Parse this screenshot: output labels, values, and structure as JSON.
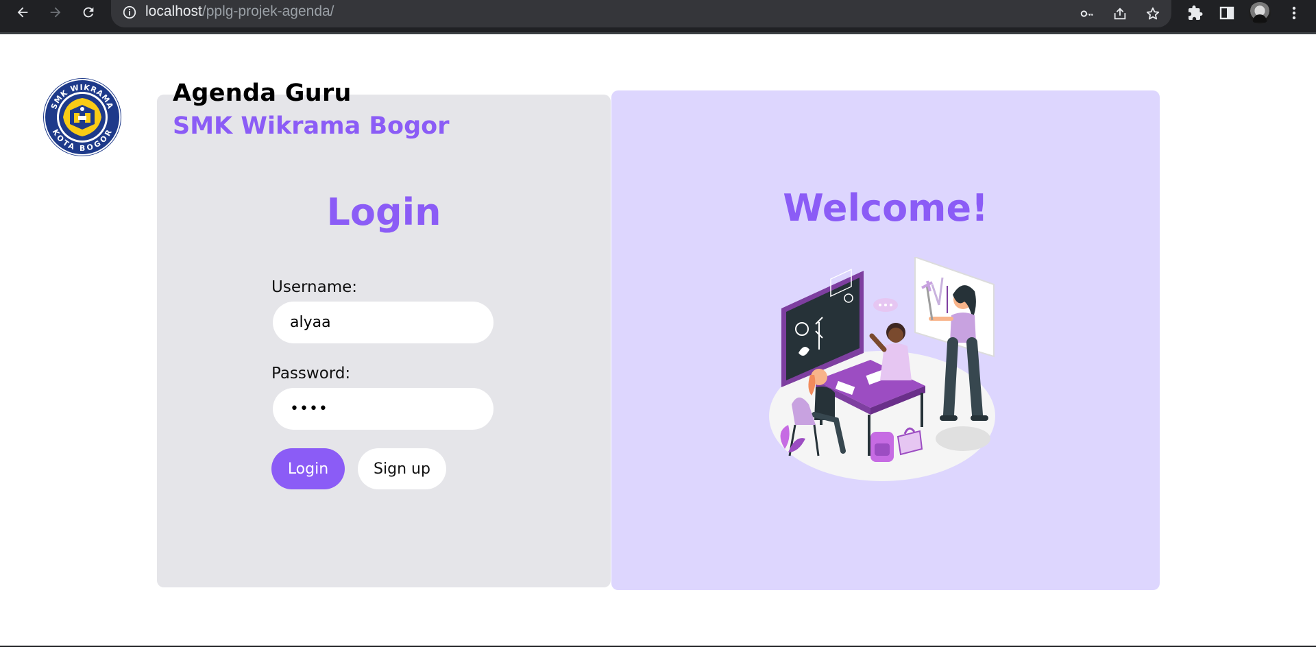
{
  "browser": {
    "url_host": "localhost",
    "url_path": "/pplg-projek-agenda/",
    "icons": [
      "back-icon",
      "forward-icon",
      "reload-icon",
      "site-info-icon",
      "key-icon",
      "share-icon",
      "star-icon",
      "extensions-icon",
      "side-panel-icon",
      "profile-avatar",
      "menu-icon"
    ]
  },
  "header": {
    "title": "Agenda Guru",
    "subtitle": "SMK Wikrama Bogor",
    "logo_text_top": "SMK WIKRAMA",
    "logo_text_bottom": "KOTA BOGOR"
  },
  "login": {
    "heading": "Login",
    "username_label": "Username:",
    "username_value": "alyaa",
    "password_label": "Password:",
    "password_value": "••••",
    "login_button": "Login",
    "signup_button": "Sign up"
  },
  "welcome": {
    "heading": "Welcome!"
  },
  "colors": {
    "accent": "#8b5cf6",
    "login_card_bg": "#e5e5e9",
    "welcome_card_bg": "#ddd6fe"
  }
}
